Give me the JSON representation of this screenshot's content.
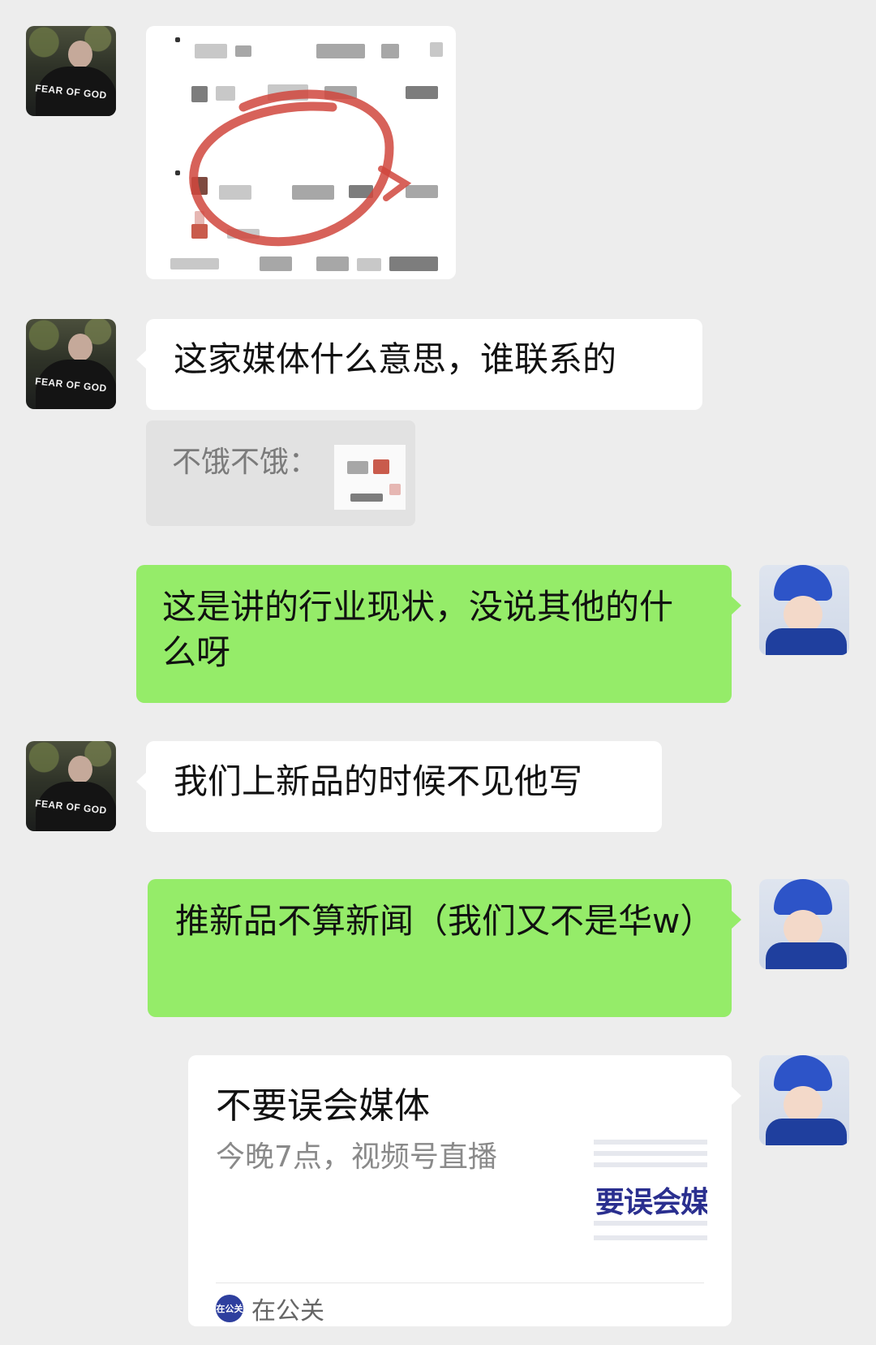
{
  "theme": {
    "background": "#ededed",
    "bubble_incoming": "#ffffff",
    "bubble_outgoing": "#95ec69",
    "quote_bg": "#e2e2e2"
  },
  "contacts": {
    "other": {
      "avatar_text": "FEAR OF GOD",
      "avatar_icon": "avatar-man"
    },
    "self": {
      "avatar_icon": "avatar-girl"
    }
  },
  "messages": [
    {
      "id": "m1",
      "sender": "other",
      "type": "image",
      "note": ""
    },
    {
      "id": "m2",
      "sender": "other",
      "type": "text",
      "text": "这家媒体什么意思，谁联系的"
    },
    {
      "id": "m3",
      "sender": "other",
      "type": "quote",
      "quote_text": "不饿不饿："
    },
    {
      "id": "m4",
      "sender": "self",
      "type": "text",
      "text": "这是讲的行业现状，没说其他的什么呀"
    },
    {
      "id": "m5",
      "sender": "other",
      "type": "text",
      "text": "我们上新品的时候不见他写"
    },
    {
      "id": "m6",
      "sender": "self",
      "type": "text",
      "text": "推新品不算新闻（我们又不是华w）"
    },
    {
      "id": "m7",
      "sender": "self",
      "type": "card",
      "title": "不要误会媒体",
      "subtitle": "今晚7点，视频号直播",
      "thumb_text": "要误会媒",
      "source": "在公关",
      "source_logo_text": "在公关"
    }
  ]
}
